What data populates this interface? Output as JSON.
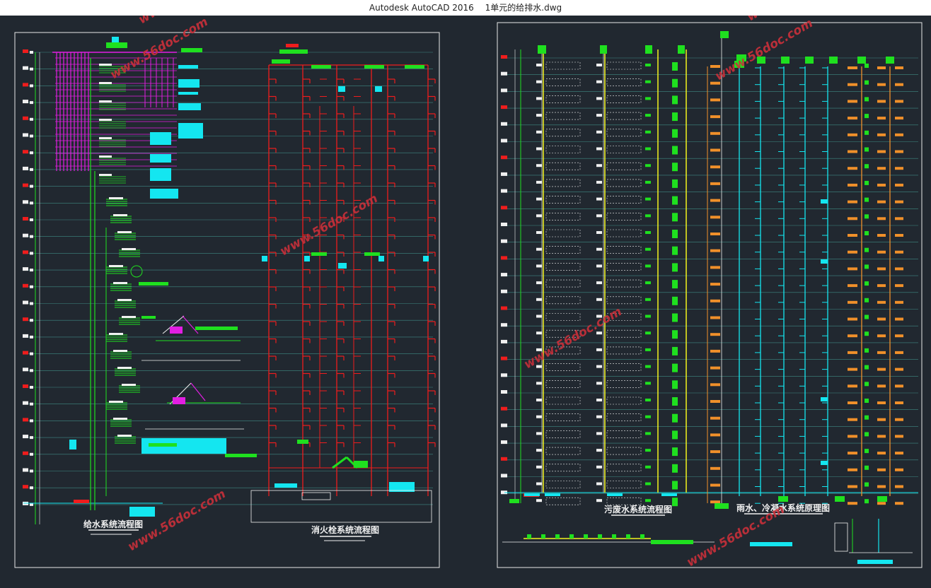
{
  "app": {
    "name": "Autodesk AutoCAD 2016",
    "document": "1单元的给排水.dwg"
  },
  "drawings": {
    "water_supply_title": "给水系统流程图",
    "fire_hydrant_title": "消火栓系统流程图",
    "sewage_title": "污废水系统流程图",
    "rain_condensate_title": "雨水、冷凝水系统原理图"
  },
  "watermark": {
    "text": "www.56doc.com"
  },
  "colors": {
    "background": "#212830",
    "green": "#1fe01f",
    "magenta": "#e21ee2",
    "cyan": "#14e6f0",
    "red": "#ef1d1d",
    "yellow": "#f4f41e",
    "orange": "#f0902a",
    "white": "#f0f0f0",
    "watermark": "#c9303a"
  }
}
